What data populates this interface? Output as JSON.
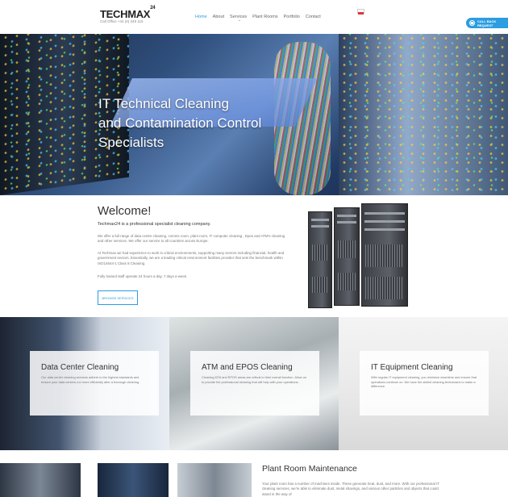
{
  "header": {
    "logo": "TECHMAX",
    "logo_sup": "24",
    "tagline": "Call Office +44 (0) 345 115",
    "nav": [
      "Home",
      "About",
      "Services",
      "Plant Rooms",
      "Portfolio",
      "Contact"
    ],
    "active_nav": "Home",
    "cta_label": "CALL BACK REQUEST"
  },
  "hero": {
    "title_line1": "IT Technical Cleaning",
    "title_line2": "and Contamination Control",
    "title_line3": "Specialists"
  },
  "welcome": {
    "title": "Welcome!",
    "subtitle": "Techmax24 is a professional specialist cleaning company.",
    "p1": "We offer a full range of data centre cleaning, comms room, plant room, IT computer cleaning , Epos and ATM's cleaning and other services. We offer our service to all countries across Europe.",
    "p2": "At Techmax we had experience to work in critical environments, supporting many sectors including financial, health and government sectors. Essentially, we are a leading critical environment facilities provider that sets the benchmark within ISO14644-1 Class 8 Cleaning.",
    "p3": "Fully trained staff operate 24 hours a day, 7 days a week.",
    "button": "BROWSE SERVICES"
  },
  "services": [
    {
      "title": "Data Center Cleaning",
      "desc": "Our data center cleaning services adhere to the highest standards and ensure your data centers run more efficiently after a thorough cleaning."
    },
    {
      "title": "ATM and EPOS Cleaning",
      "desc": "Cleaning ATM and EPOS areas are critical to their overall function. Allow us to provide the professional cleaning that will help with your operations."
    },
    {
      "title": "IT Equipment Cleaning",
      "desc": "With regular IT equipment cleaning, you minimize downtime and ensure that operations continue on. We have the skilled cleaning technicians to make a difference."
    }
  ],
  "plant": {
    "title": "Plant Room Maintenance",
    "desc": "Your plant room has a number of machines inside. These generate heat, dust, and more. With our professional IT cleaning services, we're able to eliminate dust, metal shavings, and various other particles and objects that could stand in the way of"
  },
  "colors": {
    "accent": "#2b9de0"
  }
}
